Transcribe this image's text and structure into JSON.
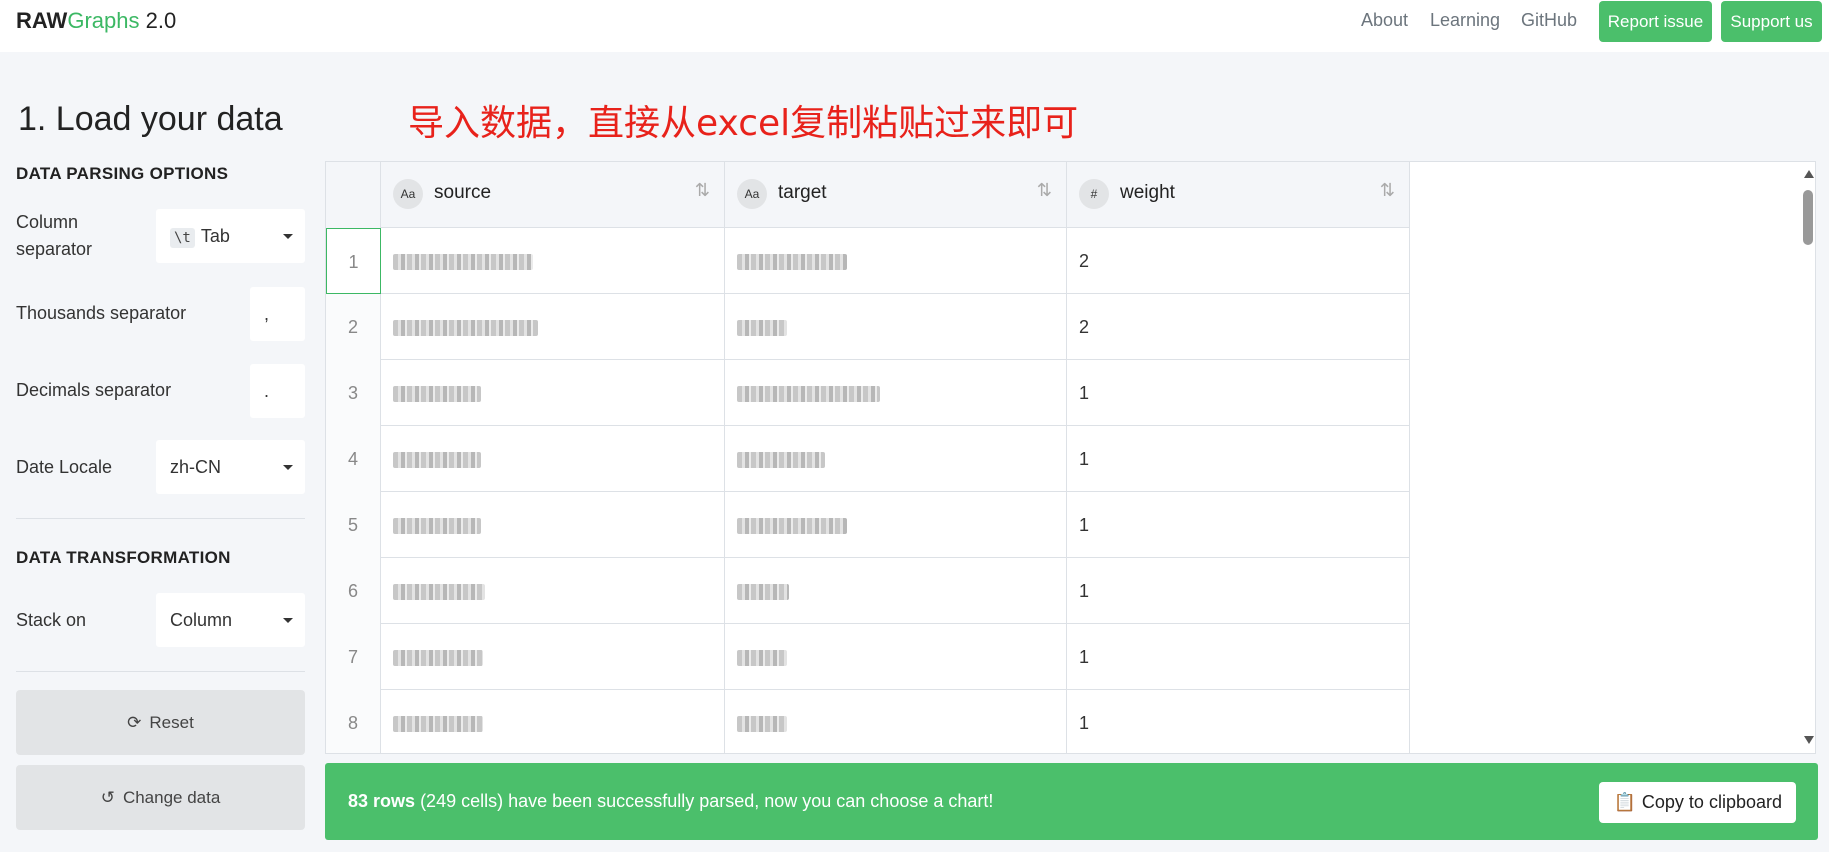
{
  "header": {
    "brand_raw": "RAW",
    "brand_graphs": "Graphs",
    "brand_version": "2.0",
    "nav": [
      "About",
      "Learning",
      "GitHub"
    ],
    "report_issue": "Report issue",
    "support_us": "Support us"
  },
  "step_title": "1. Load your data",
  "annotation": "导入数据，直接从excel复制粘贴过来即可",
  "parsing": {
    "heading": "DATA PARSING OPTIONS",
    "column_separator_label": "Column separator",
    "column_separator_chip": "\\t",
    "column_separator_value": "Tab",
    "thousands_label": "Thousands separator",
    "thousands_value": ",",
    "decimals_label": "Decimals separator",
    "decimals_value": ".",
    "date_locale_label": "Date Locale",
    "date_locale_value": "zh-CN"
  },
  "transformation": {
    "heading": "DATA TRANSFORMATION",
    "stack_on_label": "Stack on",
    "stack_on_value": "Column"
  },
  "buttons": {
    "reset": "Reset",
    "change_data": "Change data"
  },
  "table": {
    "columns": [
      {
        "type": "Aa",
        "name": "source"
      },
      {
        "type": "Aa",
        "name": "target"
      },
      {
        "type": "#",
        "name": "weight"
      }
    ],
    "rows": [
      {
        "index": "1",
        "weight": "2"
      },
      {
        "index": "2",
        "weight": "2"
      },
      {
        "index": "3",
        "weight": "1"
      },
      {
        "index": "4",
        "weight": "1"
      },
      {
        "index": "5",
        "weight": "1"
      },
      {
        "index": "6",
        "weight": "1"
      },
      {
        "index": "7",
        "weight": "1"
      },
      {
        "index": "8",
        "weight": "1"
      }
    ]
  },
  "status": {
    "rows_count": "83 rows",
    "message": "(249 cells) have been successfully parsed, now you can choose a chart!",
    "copy_button": "Copy to clipboard"
  },
  "colors": {
    "accent": "#4bbf6b",
    "brand_green": "#3cb864",
    "annotation_red": "#e8221b"
  }
}
